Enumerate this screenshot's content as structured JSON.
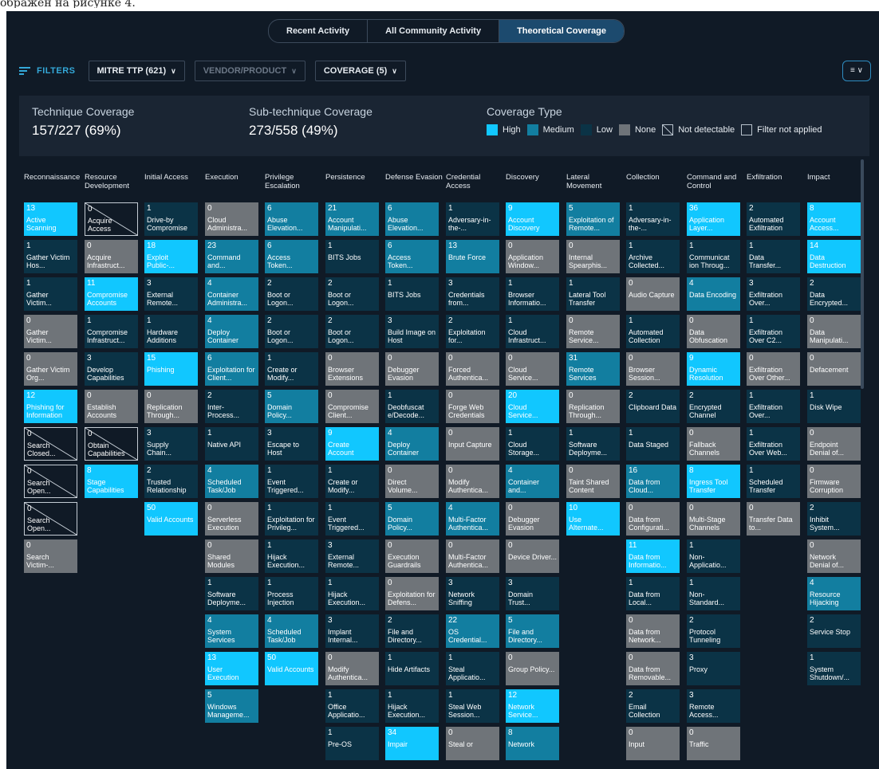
{
  "caption": "ображен на рисунке 4.",
  "tabs": [
    {
      "label": "Recent Activity"
    },
    {
      "label": "All Community Activity"
    },
    {
      "label": "Theoretical Coverage"
    }
  ],
  "filters": {
    "label": "FILTERS",
    "mitre": "MITRE TTP  (621)",
    "vendor": "VENDOR/PRODUCT",
    "coverage": "COVERAGE  (5)"
  },
  "summary": {
    "technique_title": "Technique Coverage",
    "technique_value": "157/227 (69%)",
    "sub_title": "Sub-technique Coverage",
    "sub_value": "273/558 (49%)",
    "coverage_type_title": "Coverage Type",
    "legend": {
      "high": "High",
      "medium": "Medium",
      "low": "Low",
      "none": "None",
      "not_detectable": "Not detectable",
      "filter_not_applied": "Filter not applied"
    }
  },
  "colors": {
    "high": "#11c7ff",
    "medium": "#127ea0",
    "low": "#0b3346",
    "none": "#6f7479",
    "background": "#101a26"
  },
  "columns": [
    {
      "name": "Reconnaissance",
      "cells": [
        [
          "13",
          "Active Scanning",
          "high"
        ],
        [
          "1",
          "Gather Victim Hos...",
          "low"
        ],
        [
          "1",
          "Gather Victim...",
          "low"
        ],
        [
          "0",
          "Gather Victim...",
          "none"
        ],
        [
          "0",
          "Gather Victim Org...",
          "none"
        ],
        [
          "12",
          "Phishing for Information",
          "high"
        ],
        [
          "0",
          "Search Closed...",
          "nd"
        ],
        [
          "0",
          "Search Open...",
          "nd"
        ],
        [
          "0",
          "Search Open...",
          "nd"
        ],
        [
          "0",
          "Search Victim-...",
          "none"
        ]
      ]
    },
    {
      "name": "Resource Development",
      "cells": [
        [
          "0",
          "Acquire Access",
          "nd"
        ],
        [
          "0",
          "Acquire Infrastruct...",
          "none"
        ],
        [
          "11",
          "Compromise Accounts",
          "high"
        ],
        [
          "1",
          "Compromise Infrastruct...",
          "low"
        ],
        [
          "3",
          "Develop Capabilities",
          "low"
        ],
        [
          "0",
          "Establish Accounts",
          "none"
        ],
        [
          "0",
          "Obtain Capabilities",
          "nd"
        ],
        [
          "8",
          "Stage Capabilities",
          "high"
        ]
      ]
    },
    {
      "name": "Initial Access",
      "cells": [
        [
          "1",
          "Drive-by Compromise",
          "low"
        ],
        [
          "18",
          "Exploit Public-...",
          "high"
        ],
        [
          "3",
          "External Remote...",
          "low"
        ],
        [
          "1",
          "Hardware Additions",
          "low"
        ],
        [
          "15",
          "Phishing",
          "high"
        ],
        [
          "0",
          "Replication Through...",
          "none"
        ],
        [
          "3",
          "Supply Chain...",
          "low"
        ],
        [
          "2",
          "Trusted Relationship",
          "low"
        ],
        [
          "50",
          "Valid Accounts",
          "high"
        ]
      ]
    },
    {
      "name": "Execution",
      "cells": [
        [
          "0",
          "Cloud Administra...",
          "none"
        ],
        [
          "23",
          "Command and...",
          "medium"
        ],
        [
          "4",
          "Container Administra...",
          "medium"
        ],
        [
          "4",
          "Deploy Container",
          "medium"
        ],
        [
          "6",
          "Exploitation for Client...",
          "medium"
        ],
        [
          "2",
          "Inter-Process...",
          "low"
        ],
        [
          "1",
          "Native API",
          "low"
        ],
        [
          "4",
          "Scheduled Task/Job",
          "medium"
        ],
        [
          "0",
          "Serverless Execution",
          "none"
        ],
        [
          "0",
          "Shared Modules",
          "none"
        ],
        [
          "1",
          "Software Deployme...",
          "low"
        ],
        [
          "4",
          "System Services",
          "medium"
        ],
        [
          "13",
          "User Execution",
          "high"
        ],
        [
          "5",
          "Windows Manageme...",
          "medium"
        ]
      ]
    },
    {
      "name": "Privilege Escalation",
      "cells": [
        [
          "6",
          "Abuse Elevation...",
          "medium"
        ],
        [
          "6",
          "Access Token...",
          "medium"
        ],
        [
          "2",
          "Boot or Logon...",
          "low"
        ],
        [
          "2",
          "Boot or Logon...",
          "low"
        ],
        [
          "1",
          "Create or Modify...",
          "low"
        ],
        [
          "5",
          "Domain Policy...",
          "medium"
        ],
        [
          "3",
          "Escape to Host",
          "low"
        ],
        [
          "1",
          "Event Triggered...",
          "low"
        ],
        [
          "1",
          "Exploitation for Privileg...",
          "low"
        ],
        [
          "1",
          "Hijack Execution...",
          "low"
        ],
        [
          "1",
          "Process Injection",
          "low"
        ],
        [
          "4",
          "Scheduled Task/Job",
          "medium"
        ],
        [
          "50",
          "Valid Accounts",
          "high"
        ]
      ]
    },
    {
      "name": "Persistence",
      "cells": [
        [
          "21",
          "Account Manipulati...",
          "medium"
        ],
        [
          "1",
          "BITS Jobs",
          "low"
        ],
        [
          "2",
          "Boot or Logon...",
          "low"
        ],
        [
          "2",
          "Boot or Logon...",
          "low"
        ],
        [
          "0",
          "Browser Extensions",
          "none"
        ],
        [
          "0",
          "Compromise Client...",
          "none"
        ],
        [
          "9",
          "Create Account",
          "high"
        ],
        [
          "1",
          "Create or Modify...",
          "low"
        ],
        [
          "1",
          "Event Triggered...",
          "low"
        ],
        [
          "3",
          "External Remote...",
          "low"
        ],
        [
          "1",
          "Hijack Execution...",
          "low"
        ],
        [
          "3",
          "Implant Internal...",
          "low"
        ],
        [
          "0",
          "Modify Authentica...",
          "none"
        ],
        [
          "1",
          "Office Applicatio...",
          "low"
        ],
        [
          "1",
          "Pre-OS",
          "low"
        ]
      ]
    },
    {
      "name": "Defense Evasion",
      "cells": [
        [
          "6",
          "Abuse Elevation...",
          "medium"
        ],
        [
          "6",
          "Access Token...",
          "medium"
        ],
        [
          "1",
          "BITS Jobs",
          "low"
        ],
        [
          "3",
          "Build Image on Host",
          "low"
        ],
        [
          "0",
          "Debugger Evasion",
          "none"
        ],
        [
          "1",
          "Deobfuscat e/Decode...",
          "low"
        ],
        [
          "4",
          "Deploy Container",
          "medium"
        ],
        [
          "0",
          "Direct Volume...",
          "none"
        ],
        [
          "5",
          "Domain Policy...",
          "medium"
        ],
        [
          "0",
          "Execution Guardrails",
          "none"
        ],
        [
          "0",
          "Exploitation for Defens...",
          "none"
        ],
        [
          "2",
          "File and Directory...",
          "low"
        ],
        [
          "1",
          "Hide Artifacts",
          "low"
        ],
        [
          "1",
          "Hijack Execution...",
          "low"
        ],
        [
          "34",
          "Impair",
          "high"
        ]
      ]
    },
    {
      "name": "Credential Access",
      "cells": [
        [
          "1",
          "Adversary-in-the-...",
          "low"
        ],
        [
          "13",
          "Brute Force",
          "medium"
        ],
        [
          "3",
          "Credentials from...",
          "low"
        ],
        [
          "2",
          "Exploitation for...",
          "low"
        ],
        [
          "0",
          "Forced Authentica...",
          "none"
        ],
        [
          "0",
          "Forge Web Credentials",
          "none"
        ],
        [
          "0",
          "Input Capture",
          "none"
        ],
        [
          "0",
          "Modify Authentica...",
          "none"
        ],
        [
          "4",
          "Multi-Factor Authentica...",
          "medium"
        ],
        [
          "0",
          "Multi-Factor Authentica...",
          "none"
        ],
        [
          "3",
          "Network Sniffing",
          "low"
        ],
        [
          "22",
          "OS Credential...",
          "medium"
        ],
        [
          "1",
          "Steal Applicatio...",
          "low"
        ],
        [
          "1",
          "Steal Web Session...",
          "low"
        ],
        [
          "0",
          "Steal or",
          "none"
        ]
      ]
    },
    {
      "name": "Discovery",
      "cells": [
        [
          "9",
          "Account Discovery",
          "high"
        ],
        [
          "0",
          "Application Window...",
          "none"
        ],
        [
          "1",
          "Browser Informatio...",
          "low"
        ],
        [
          "1",
          "Cloud Infrastruct...",
          "low"
        ],
        [
          "0",
          "Cloud Service...",
          "none"
        ],
        [
          "20",
          "Cloud Service...",
          "high"
        ],
        [
          "1",
          "Cloud Storage...",
          "low"
        ],
        [
          "4",
          "Container and...",
          "medium"
        ],
        [
          "0",
          "Debugger Evasion",
          "none"
        ],
        [
          "0",
          "Device Driver...",
          "none"
        ],
        [
          "3",
          "Domain Trust...",
          "low"
        ],
        [
          "5",
          "File and Directory...",
          "medium"
        ],
        [
          "0",
          "Group Policy...",
          "none"
        ],
        [
          "12",
          "Network Service...",
          "high"
        ],
        [
          "8",
          "Network",
          "medium"
        ]
      ]
    },
    {
      "name": "Lateral Movement",
      "cells": [
        [
          "5",
          "Exploitation of Remote...",
          "medium"
        ],
        [
          "0",
          "Internal Spearphis...",
          "none"
        ],
        [
          "1",
          "Lateral Tool Transfer",
          "low"
        ],
        [
          "0",
          "Remote Service...",
          "none"
        ],
        [
          "31",
          "Remote Services",
          "medium"
        ],
        [
          "0",
          "Replication Through...",
          "none"
        ],
        [
          "1",
          "Software Deployme...",
          "low"
        ],
        [
          "0",
          "Taint Shared Content",
          "none"
        ],
        [
          "10",
          "Use Alternate...",
          "high"
        ]
      ]
    },
    {
      "name": "Collection",
      "cells": [
        [
          "1",
          "Adversary-in-the-...",
          "low"
        ],
        [
          "1",
          "Archive Collected...",
          "low"
        ],
        [
          "0",
          "Audio Capture",
          "none"
        ],
        [
          "1",
          "Automated Collection",
          "low"
        ],
        [
          "0",
          "Browser Session...",
          "none"
        ],
        [
          "2",
          "Clipboard Data",
          "low"
        ],
        [
          "1",
          "Data Staged",
          "low"
        ],
        [
          "16",
          "Data from Cloud...",
          "medium"
        ],
        [
          "0",
          "Data from Configurati...",
          "none"
        ],
        [
          "11",
          "Data from Informatio...",
          "high"
        ],
        [
          "1",
          "Data from Local...",
          "low"
        ],
        [
          "0",
          "Data from Network...",
          "none"
        ],
        [
          "0",
          "Data from Removable...",
          "none"
        ],
        [
          "2",
          "Email Collection",
          "low"
        ],
        [
          "0",
          "Input",
          "none"
        ]
      ]
    },
    {
      "name": "Command and Control",
      "cells": [
        [
          "36",
          "Application Layer...",
          "high"
        ],
        [
          "1",
          "Communicat ion Throug...",
          "low"
        ],
        [
          "4",
          "Data Encoding",
          "medium"
        ],
        [
          "0",
          "Data Obfuscation",
          "none"
        ],
        [
          "9",
          "Dynamic Resolution",
          "high"
        ],
        [
          "2",
          "Encrypted Channel",
          "low"
        ],
        [
          "0",
          "Fallback Channels",
          "none"
        ],
        [
          "8",
          "Ingress Tool Transfer",
          "high"
        ],
        [
          "0",
          "Multi-Stage Channels",
          "none"
        ],
        [
          "1",
          "Non-Applicatio...",
          "low"
        ],
        [
          "1",
          "Non-Standard...",
          "low"
        ],
        [
          "2",
          "Protocol Tunneling",
          "low"
        ],
        [
          "3",
          "Proxy",
          "low"
        ],
        [
          "3",
          "Remote Access...",
          "low"
        ],
        [
          "0",
          "Traffic",
          "none"
        ]
      ]
    },
    {
      "name": "Exfiltration",
      "cells": [
        [
          "2",
          "Automated Exfiltration",
          "low"
        ],
        [
          "1",
          "Data Transfer...",
          "low"
        ],
        [
          "3",
          "Exfiltration Over...",
          "low"
        ],
        [
          "1",
          "Exfiltration Over C2...",
          "low"
        ],
        [
          "0",
          "Exfiltration Over Other...",
          "none"
        ],
        [
          "1",
          "Exfiltration Over...",
          "low"
        ],
        [
          "1",
          "Exfiltration Over Web...",
          "low"
        ],
        [
          "1",
          "Scheduled Transfer",
          "low"
        ],
        [
          "0",
          "Transfer Data to...",
          "none"
        ]
      ]
    },
    {
      "name": "Impact",
      "cells": [
        [
          "8",
          "Account Access...",
          "high"
        ],
        [
          "14",
          "Data Destruction",
          "high"
        ],
        [
          "2",
          "Data Encrypted...",
          "low"
        ],
        [
          "0",
          "Data Manipulati...",
          "none"
        ],
        [
          "0",
          "Defacement",
          "none"
        ],
        [
          "1",
          "Disk Wipe",
          "low"
        ],
        [
          "0",
          "Endpoint Denial of...",
          "none"
        ],
        [
          "0",
          "Firmware Corruption",
          "none"
        ],
        [
          "2",
          "Inhibit System...",
          "low"
        ],
        [
          "0",
          "Network Denial of...",
          "none"
        ],
        [
          "4",
          "Resource Hijacking",
          "medium"
        ],
        [
          "2",
          "Service Stop",
          "low"
        ],
        [
          "1",
          "System Shutdown/...",
          "low"
        ]
      ]
    }
  ]
}
